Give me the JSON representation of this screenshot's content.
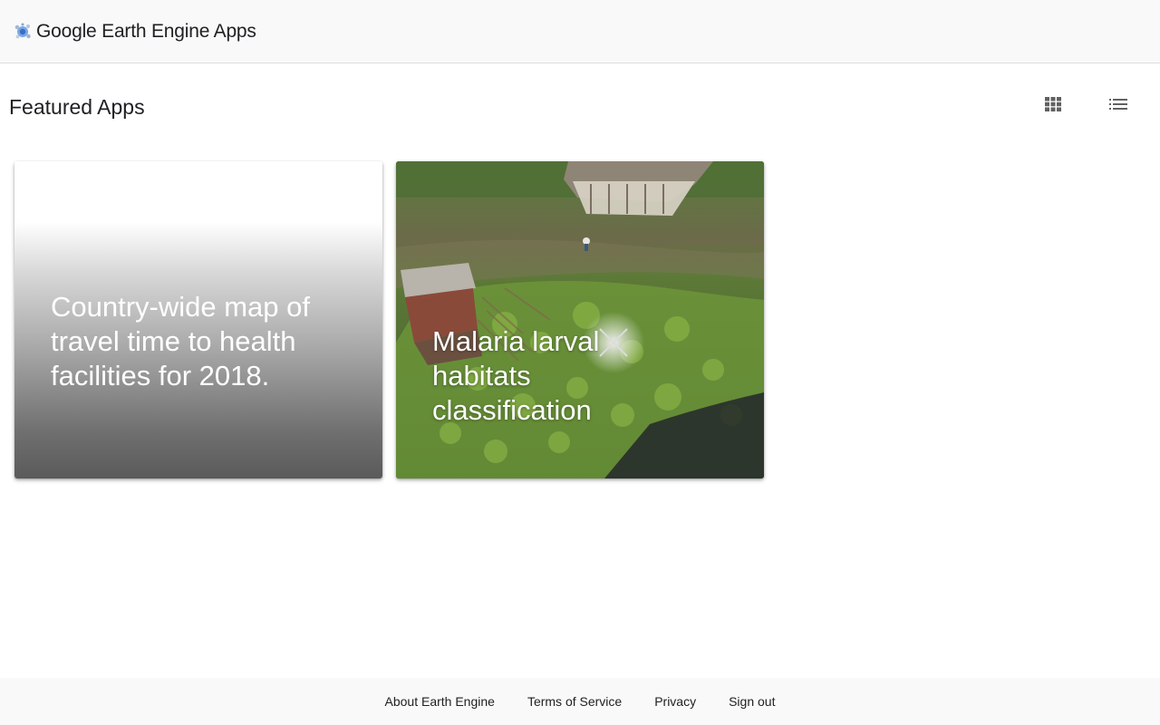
{
  "header": {
    "title": "Google Earth Engine Apps",
    "logo_icon": "earth-engine-logo-icon"
  },
  "main": {
    "section_title": "Featured Apps",
    "view_toggle": {
      "grid_icon": "grid-view-icon",
      "list_icon": "list-view-icon"
    },
    "cards": [
      {
        "title": "Country-wide map of travel time to health facilities for 2018."
      },
      {
        "title": "Malaria larval habitats classification"
      }
    ]
  },
  "footer": {
    "links": [
      "About Earth Engine",
      "Terms of Service",
      "Privacy",
      "Sign out"
    ]
  },
  "colors": {
    "header_bg": "#f9f9f9",
    "footer_bg": "#f9f9f9",
    "text": "#202124"
  }
}
